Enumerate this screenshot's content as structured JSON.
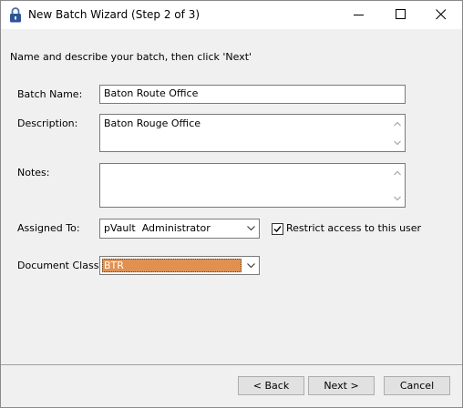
{
  "window": {
    "title": "New Batch Wizard (Step 2 of 3)"
  },
  "instruction": "Name and describe your batch, then click 'Next'",
  "form": {
    "batch_name_label": "Batch Name:",
    "batch_name_value": "Baton Route Office",
    "description_label": "Description:",
    "description_value": "Baton Rouge Office",
    "notes_label": "Notes:",
    "notes_value": "",
    "assigned_to_label": "Assigned To:",
    "assigned_to_value": "pVault  Administrator",
    "restrict_label": "Restrict access to this user",
    "restrict_checked": true,
    "document_class_label": "Document Class:",
    "document_class_value": "BTR"
  },
  "buttons": {
    "back": "< Back",
    "next": "Next >",
    "cancel": "Cancel"
  },
  "colors": {
    "document_class_highlight": "#e09152"
  },
  "icons": {
    "app": "padlock-icon",
    "minimize": "minimize-icon",
    "maximize": "maximize-icon",
    "close": "close-icon"
  }
}
